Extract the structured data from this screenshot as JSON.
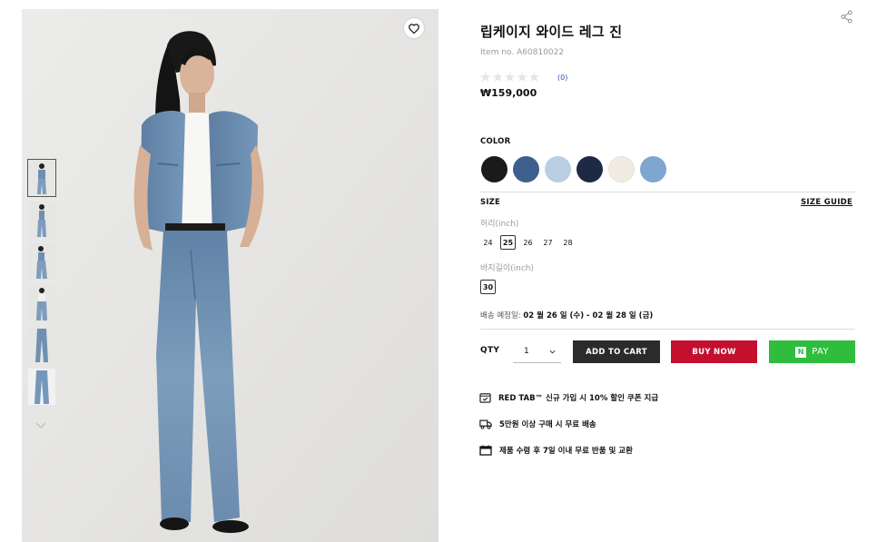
{
  "product": {
    "title": "립케이지 와이드 레그 진",
    "item_no_label": "Item no.",
    "item_no": "A60810022",
    "stars": "★★★★★",
    "review_count": "(0)",
    "price": "₩159,000"
  },
  "color": {
    "label": "COLOR",
    "swatches": [
      {
        "name": "black",
        "hex": "#1a1a1a"
      },
      {
        "name": "dark-blue-denim",
        "hex": "#3d5f8e"
      },
      {
        "name": "light-blue-denim",
        "hex": "#b9cde3"
      },
      {
        "name": "navy-denim",
        "hex": "#1e2a44"
      },
      {
        "name": "ecru",
        "hex": "#f1ece1"
      },
      {
        "name": "mid-blue-denim",
        "hex": "#7fa6cf"
      }
    ]
  },
  "size": {
    "label": "SIZE",
    "guide_label": "SIZE GUIDE",
    "waist_label": "허리(inch)",
    "waist_options": [
      "24",
      "25",
      "26",
      "27",
      "28"
    ],
    "waist_selected": "25",
    "length_label": "바지길이(inch)",
    "length_options": [
      "30"
    ],
    "length_selected": "30"
  },
  "delivery": {
    "label": "배송 예정일:",
    "range": "02 월 26 일 (수) - 02 월 28 일 (금)"
  },
  "purchase": {
    "qty_label": "QTY",
    "qty_value": "1",
    "add_to_cart": "ADD TO CART",
    "buy_now": "BUY NOW",
    "npay_logo": "N",
    "npay_label": "PAY"
  },
  "benefits": [
    "RED TAB™ 신규 가입 시 10% 할인 쿠폰 지급",
    "5만원 이상 구매 시 무료 배송",
    "제품 수령 후 7일 이내 무료 반품 및 교환"
  ],
  "colors": {
    "accent_red": "#c4102e",
    "npay_green": "#2fbd3e",
    "cart_dark": "#2b2b2b"
  }
}
